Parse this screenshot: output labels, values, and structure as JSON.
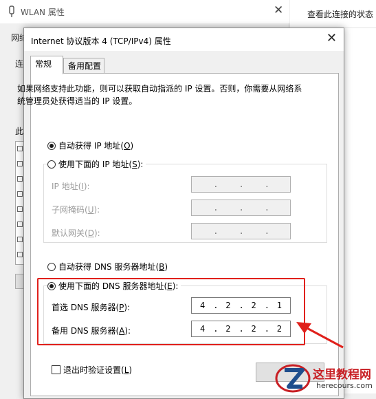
{
  "background_window": {
    "title": "WLAN 属性",
    "frags": {
      "network": "网络",
      "connect": "连",
      "this": "此"
    }
  },
  "right_panel": {
    "link": "查看此连接的状态"
  },
  "dialog": {
    "title": "Internet 协议版本 4 (TCP/IPv4) 属性",
    "tabs": [
      "常规",
      "备用配置"
    ],
    "description": "如果网络支持此功能，则可以获取自动指派的 IP 设置。否则，你需要从网络系统管理员处获得适当的 IP 设置。",
    "auto_ip": {
      "label": "自动获得 IP 地址(",
      "key": "O",
      "end": ")",
      "selected": true
    },
    "manual_ip": {
      "label": "使用下面的 IP 地址(",
      "key": "S",
      "end": "):",
      "selected": false
    },
    "ip_fields": [
      {
        "label": "IP 地址(",
        "key": "I",
        "end": "):",
        "octets": [
          "",
          "",
          "",
          ""
        ]
      },
      {
        "label": "子网掩码(",
        "key": "U",
        "end": "):",
        "octets": [
          "",
          "",
          "",
          ""
        ]
      },
      {
        "label": "默认网关(",
        "key": "D",
        "end": "):",
        "octets": [
          "",
          "",
          "",
          ""
        ]
      }
    ],
    "auto_dns": {
      "label": "自动获得 DNS 服务器地址(",
      "key": "B",
      "end": ")",
      "selected": false
    },
    "manual_dns": {
      "label": "使用下面的 DNS 服务器地址(",
      "key": "E",
      "end": "):",
      "selected": true
    },
    "dns_fields": [
      {
        "label": "首选 DNS 服务器(",
        "key": "P",
        "end": "):",
        "octets": [
          "4",
          "2",
          "2",
          "1"
        ]
      },
      {
        "label": "备用 DNS 服务器(",
        "key": "A",
        "end": "):",
        "octets": [
          "4",
          "2",
          "2",
          "2"
        ]
      }
    ],
    "validate_on_exit": {
      "label": "退出时验证设置(",
      "key": "L",
      "end": ")",
      "checked": false
    }
  },
  "watermark": {
    "text": "这里教程网",
    "url": "herecours.com"
  },
  "colors": {
    "highlight": "#e0201b",
    "watermark_red": "#c81f24"
  }
}
